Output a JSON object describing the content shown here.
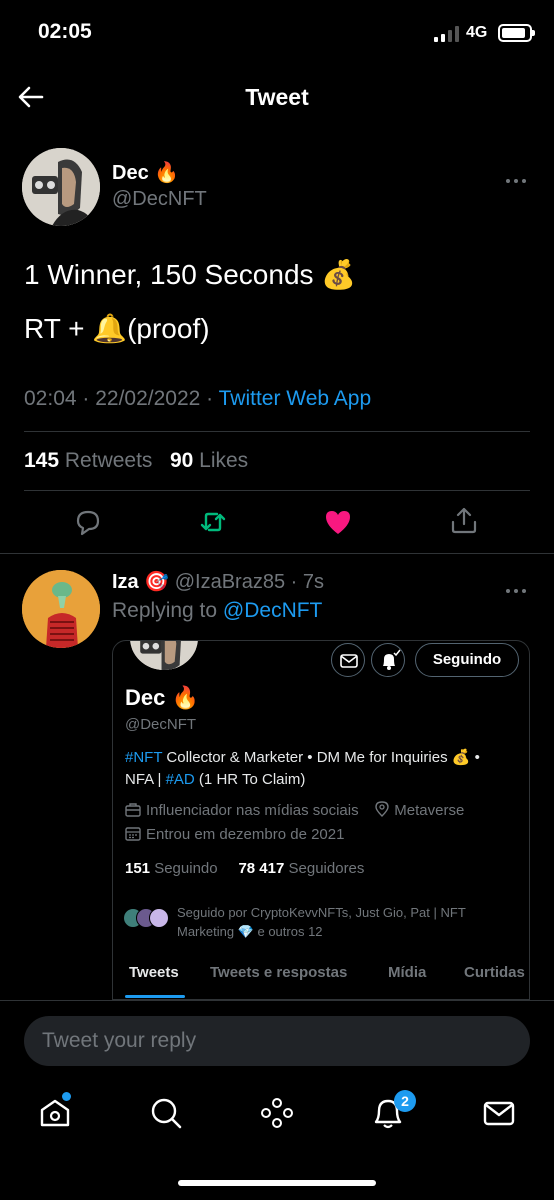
{
  "status_bar": {
    "time": "02:05",
    "network": "4G"
  },
  "header": {
    "title": "Tweet"
  },
  "tweet": {
    "author_name": "Dec",
    "author_emoji": "🔥",
    "handle": "@DecNFT",
    "line1": "1 Winner, 150 Seconds 💰",
    "line2": "RT + 🔔(proof)",
    "time_date": "02:04 · 22/02/2022 · ",
    "source": "Twitter Web App",
    "retweets_count": "145",
    "retweets_label": "Retweets",
    "likes_count": "90",
    "likes_label": "Likes",
    "colors": {
      "retweet": "#00ba7c",
      "like": "#f91880"
    }
  },
  "reply": {
    "author_name": "Iza",
    "author_emoji": "🎯",
    "handle_time": "@IzaBraz85 · 7s",
    "replying_prefix": "Replying to ",
    "replying_handle": "@DecNFT",
    "card": {
      "follow_label": "Seguindo",
      "name": "Dec",
      "name_emoji": "🔥",
      "handle": "@DecNFT",
      "bio_tag1": "#NFT",
      "bio_part1": " Collector & Marketer • DM Me for Inquiries 💰 •",
      "bio_part2": "NFA | ",
      "bio_tag2": "#AD",
      "bio_part3": " (1 HR To Claim)",
      "category": "Influenciador nas mídias sociais",
      "location": "Metaverse",
      "joined": "Entrou em dezembro de 2021",
      "following_count": "151",
      "following_label": "Seguindo",
      "followers_count": "78 417",
      "followers_label": "Seguidores",
      "followed_by": "Seguido por CryptoKevvNFTs, Just Gio, Pat | NFT Marketing 💎 e outros 12",
      "tabs": [
        "Tweets",
        "Tweets e respostas",
        "Mídia",
        "Curtidas"
      ]
    }
  },
  "composer": {
    "placeholder": "Tweet your reply"
  },
  "bottom_nav": {
    "items": [
      "home-icon",
      "search-icon",
      "spaces-icon",
      "notifications-icon",
      "messages-icon"
    ],
    "notifications_badge": "2"
  },
  "colors": {
    "accent": "#1d9bf0",
    "background": "#000000",
    "muted": "#71767b"
  }
}
